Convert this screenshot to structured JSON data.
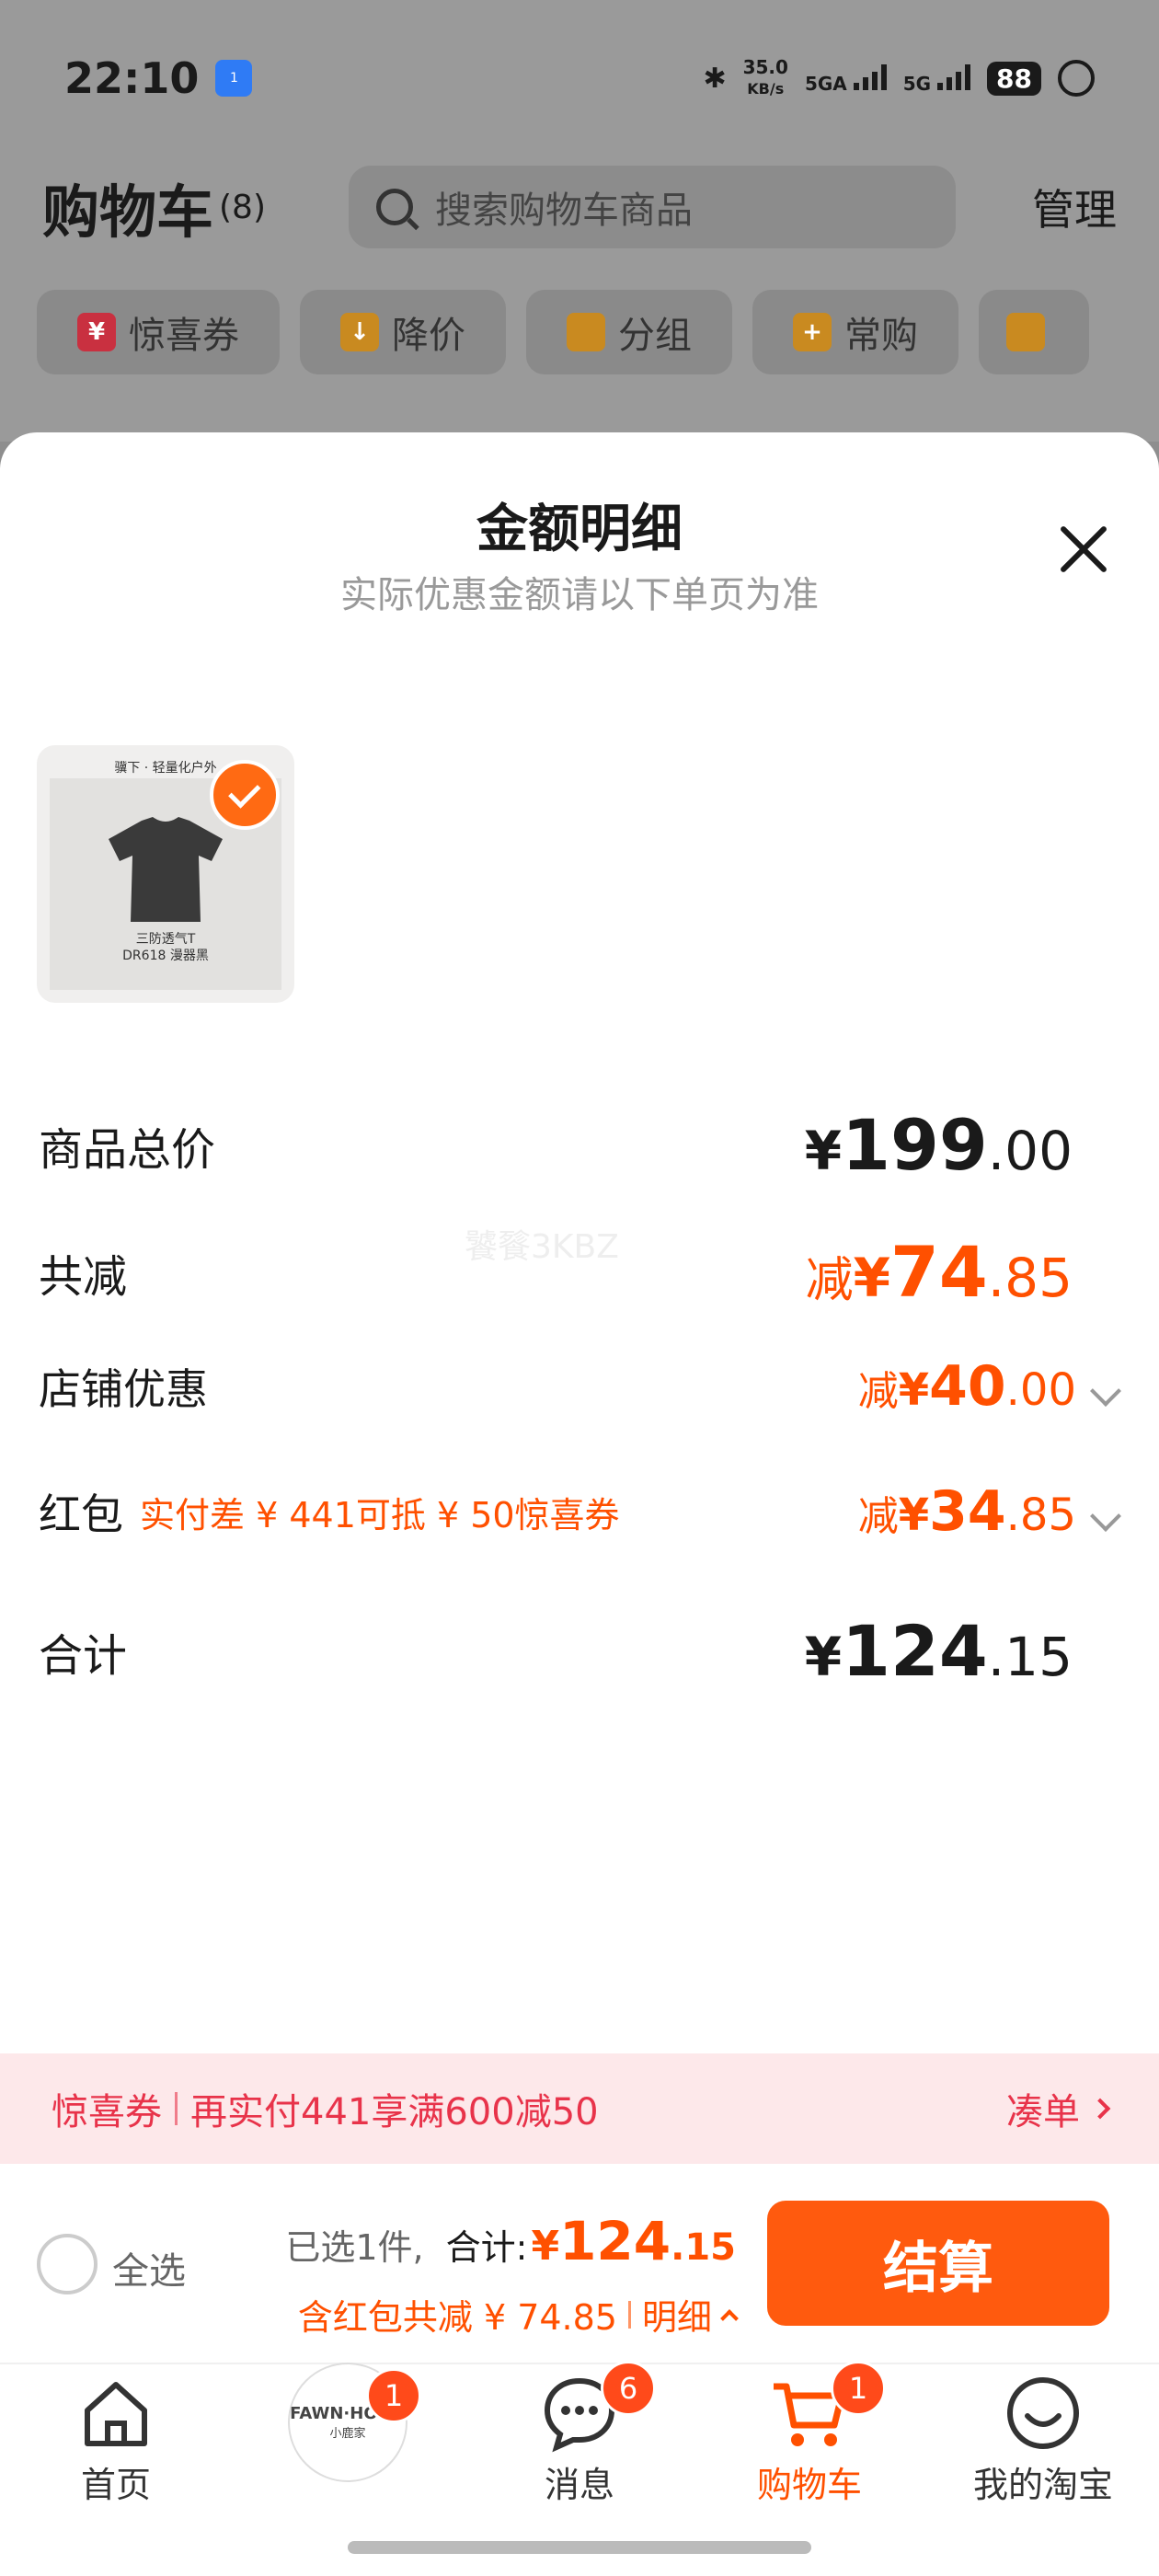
{
  "status_bar": {
    "time": "22:10",
    "hotspot": "1",
    "speed_value": "35.0",
    "speed_unit": "KB/s",
    "sim1": "5GA",
    "sim2": "5G",
    "battery": "88"
  },
  "cart": {
    "title": "购物车",
    "count": "(8)",
    "search_placeholder": "搜索购物车商品",
    "manage": "管理",
    "chips": [
      {
        "label": "惊喜券",
        "icon": "coupon-icon"
      },
      {
        "label": "降价",
        "icon": "price-drop-icon"
      },
      {
        "label": "分组",
        "icon": "folder-icon"
      },
      {
        "label": "常购",
        "icon": "cart-plus-icon"
      }
    ]
  },
  "sheet": {
    "title": "金额明细",
    "subtitle": "实际优惠金额请以下单页为准",
    "product": {
      "brand_line": "骥下 · 轻量化户外",
      "caption_line1": "三防透气T",
      "caption_line2": "DR618 漫器黑"
    },
    "watermark": "饕餮3KBZ",
    "rows": {
      "total": {
        "label": "商品总价",
        "currency": "¥",
        "integer": "199",
        "decimal": ".00"
      },
      "discount": {
        "label": "共减",
        "prefix": "减",
        "currency": "¥",
        "integer": "74",
        "decimal": ".85"
      },
      "store": {
        "label": "店铺优惠",
        "prefix": "减",
        "currency": "¥",
        "integer": "40",
        "decimal": ".00"
      },
      "redpacket": {
        "label": "红包",
        "note": "实付差 ¥ 441可抵 ¥ 50惊喜券",
        "prefix": "减",
        "currency": "¥",
        "integer": "34",
        "decimal": ".85"
      },
      "sum": {
        "label": "合计",
        "currency": "¥",
        "integer": "124",
        "decimal": ".15"
      }
    }
  },
  "coupon_bar": {
    "tag": "惊喜券",
    "message": "再实付441享满600减50",
    "action": "凑单"
  },
  "checkout": {
    "select_all": "全选",
    "selected": "已选1件,",
    "total_label": "合计:",
    "total_currency": "¥",
    "total_integer": "124",
    "total_decimal": ".15",
    "discount_note": "含红包共减 ¥ 74.85",
    "detail": "明细",
    "pay": "结算"
  },
  "tabbar": [
    {
      "label": "首页",
      "icon": "home-icon"
    },
    {
      "label": "",
      "icon": "store-logo-icon",
      "badge": "1",
      "logo_line1": "FAWN·HOME",
      "logo_line2": "小鹿家"
    },
    {
      "label": "消息",
      "icon": "message-icon",
      "badge": "6"
    },
    {
      "label": "购物车",
      "icon": "cart-icon",
      "badge": "1"
    },
    {
      "label": "我的淘宝",
      "icon": "smile-icon"
    }
  ],
  "colors": {
    "accent": "#ff5000",
    "coupon_red": "#e8334a",
    "pay_button": "#ff5a0e"
  }
}
